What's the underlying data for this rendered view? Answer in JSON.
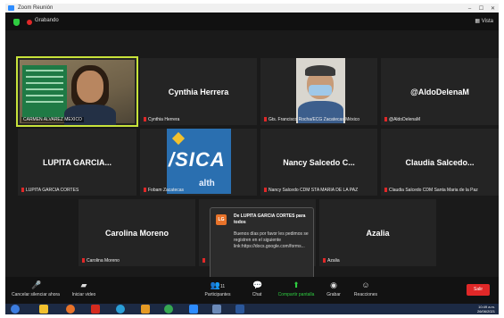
{
  "window": {
    "title": "Zoom Reunión"
  },
  "topbar": {
    "recording_label": "Grabando",
    "view_label": "Vista"
  },
  "tiles": [
    {
      "caption": "CARMEN ALVAREZ MEXICO"
    },
    {
      "big": "Cynthia Herrera",
      "caption": "Cynthia Herrera"
    },
    {
      "caption": "Gts. Francisco Rocha/ECG Zacatecas México"
    },
    {
      "big": "@AldoDelenaM",
      "caption": "@AldoDelenaM"
    },
    {
      "big": "LUPITA GARCIA...",
      "caption": "LUPITA GARCIA CORTES"
    },
    {
      "caption": "Fobam Zacatecas"
    },
    {
      "big": "Nancy Salcedo C...",
      "caption": "Nancy Salcedo CDM STA MARIA DE LA PAZ"
    },
    {
      "big": "Claudia Salcedo...",
      "caption": "Claudia Salcedo CDM Santa Maria de la Paz"
    },
    {
      "big": "Carolina Moreno",
      "caption": "Carolina Moreno"
    },
    {
      "big": "Azalia",
      "caption": "Azalia"
    }
  ],
  "chat_popup": {
    "badge": "LG",
    "from": "De LUPITA GARCIA CORTES para todos",
    "message": "Buenos días por favor les pedimos se registren en el siguiente link:https://docs.google.com/forms..."
  },
  "toolbar": {
    "mute": "Cancelar silenciar ahora",
    "video": "Iniciar video",
    "participants": "Participantes",
    "participants_count": "11",
    "chat": "Chat",
    "share": "Compartir pantalla",
    "record": "Grabar",
    "reactions": "Reacciones",
    "end": "Salir"
  },
  "tray": {
    "time": "10:49 a.m.",
    "date": "26/06/2021"
  }
}
